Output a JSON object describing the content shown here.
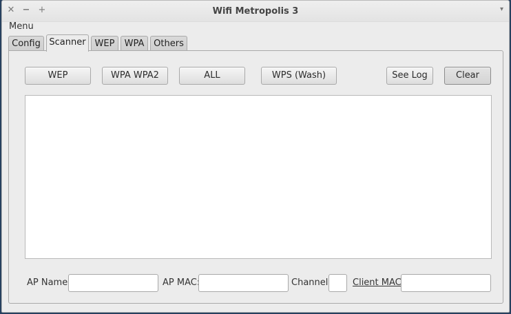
{
  "window": {
    "title": "Wifi Metropolis 3",
    "controls": {
      "close": "✕",
      "minimize": "−",
      "maximize": "+",
      "menu_arrow": "▾"
    }
  },
  "menubar": {
    "menu_label": "Menu"
  },
  "tabs": [
    {
      "label": "Config",
      "active": false
    },
    {
      "label": "Scanner",
      "active": true
    },
    {
      "label": "WEP",
      "active": false
    },
    {
      "label": "WPA",
      "active": false
    },
    {
      "label": "Others",
      "active": false
    }
  ],
  "scanner": {
    "buttons": {
      "wep": "WEP",
      "wpa_wpa2": "WPA WPA2",
      "all": "ALL",
      "wps_wash": "WPS (Wash)",
      "see_log": "See Log",
      "clear": "Clear"
    },
    "results_text": "",
    "fields": {
      "ap_name_label": "AP Name:",
      "ap_name_value": "",
      "ap_mac_label": "AP MAC:",
      "ap_mac_value": "",
      "channel_label": "Channel:",
      "channel_value": "",
      "client_mac_label": "Client MAC:",
      "client_mac_value": ""
    }
  },
  "colors": {
    "desktop": "#27405f",
    "window_bg": "#ececec"
  }
}
